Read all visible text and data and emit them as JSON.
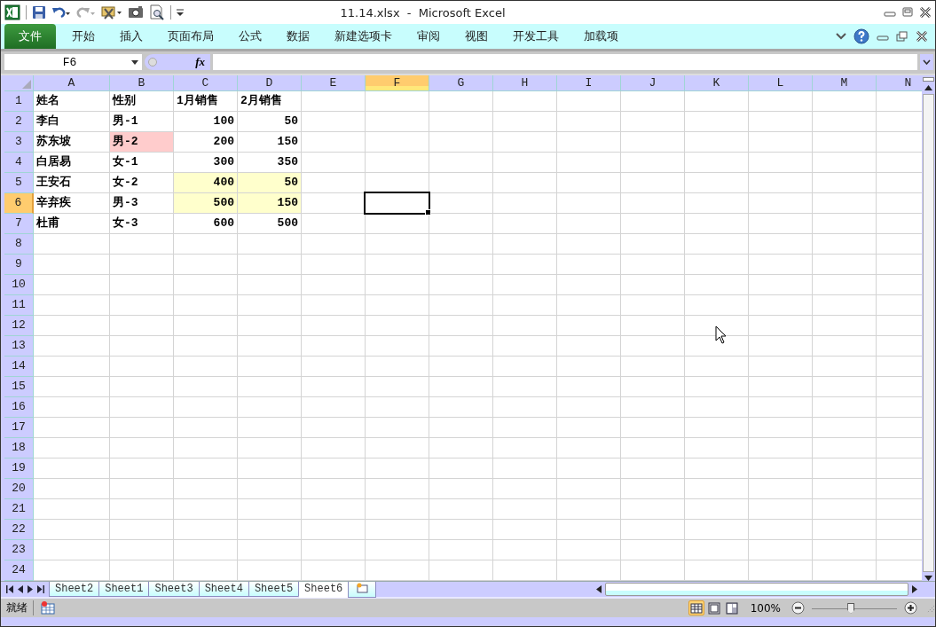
{
  "title_bar": {
    "title": "11.14.xlsx  -  Microsoft Excel"
  },
  "ribbon_tabs": [
    {
      "label": "文件",
      "kind": "file"
    },
    {
      "label": "开始",
      "kind": "tab"
    },
    {
      "label": "插入",
      "kind": "tab"
    },
    {
      "label": "页面布局",
      "kind": "tab"
    },
    {
      "label": "公式",
      "kind": "tab"
    },
    {
      "label": "数据",
      "kind": "tab"
    },
    {
      "label": "新建选项卡",
      "kind": "tab"
    },
    {
      "label": "审阅",
      "kind": "tab"
    },
    {
      "label": "视图",
      "kind": "tab"
    },
    {
      "label": "开发工具",
      "kind": "tab"
    },
    {
      "label": "加载项",
      "kind": "tab"
    }
  ],
  "formula_bar": {
    "name_box": "F6",
    "function_label": "fx"
  },
  "columns": [
    {
      "label": "A",
      "selected": false
    },
    {
      "label": "B",
      "selected": false
    },
    {
      "label": "C",
      "selected": false
    },
    {
      "label": "D",
      "selected": false
    },
    {
      "label": "E",
      "selected": false
    },
    {
      "label": "F",
      "selected": true
    },
    {
      "label": "G",
      "selected": false
    },
    {
      "label": "H",
      "selected": false
    },
    {
      "label": "I",
      "selected": false
    },
    {
      "label": "J",
      "selected": false
    },
    {
      "label": "K",
      "selected": false
    },
    {
      "label": "L",
      "selected": false
    },
    {
      "label": "M",
      "selected": false
    },
    {
      "label": "N",
      "selected": false
    }
  ],
  "rows": [
    {
      "label": "1",
      "selected": false,
      "cells": [
        {
          "text": "姓名",
          "kind": "text"
        },
        {
          "text": "性别",
          "kind": "text"
        },
        {
          "text": "1月销售",
          "kind": "text"
        },
        {
          "text": "2月销售",
          "kind": "text"
        }
      ]
    },
    {
      "label": "2",
      "selected": false,
      "cells": [
        {
          "text": "李白",
          "kind": "text"
        },
        {
          "text": "男-1",
          "kind": "text"
        },
        {
          "text": "100",
          "kind": "number"
        },
        {
          "text": "50",
          "kind": "number"
        }
      ]
    },
    {
      "label": "3",
      "selected": false,
      "cells": [
        {
          "text": "苏东坡",
          "kind": "text"
        },
        {
          "text": "男-2",
          "kind": "text",
          "color": "#ffcccc"
        },
        {
          "text": "200",
          "kind": "number"
        },
        {
          "text": "150",
          "kind": "number"
        }
      ]
    },
    {
      "label": "4",
      "selected": false,
      "cells": [
        {
          "text": "白居易",
          "kind": "text"
        },
        {
          "text": "女-1",
          "kind": "text"
        },
        {
          "text": "300",
          "kind": "number"
        },
        {
          "text": "350",
          "kind": "number"
        }
      ]
    },
    {
      "label": "5",
      "selected": false,
      "cells": [
        {
          "text": "王安石",
          "kind": "text"
        },
        {
          "text": "女-2",
          "kind": "text"
        },
        {
          "text": "400",
          "kind": "number",
          "color": "#ffffcc"
        },
        {
          "text": "50",
          "kind": "number",
          "color": "#ffffcc"
        }
      ]
    },
    {
      "label": "6",
      "selected": true,
      "cells": [
        {
          "text": "辛弃疾",
          "kind": "text"
        },
        {
          "text": "男-3",
          "kind": "text"
        },
        {
          "text": "500",
          "kind": "number",
          "color": "#ffffcc"
        },
        {
          "text": "150",
          "kind": "number",
          "color": "#ffffcc"
        }
      ]
    },
    {
      "label": "7",
      "selected": false,
      "cells": [
        {
          "text": "杜甫",
          "kind": "text"
        },
        {
          "text": "女-3",
          "kind": "text"
        },
        {
          "text": "600",
          "kind": "number"
        },
        {
          "text": "500",
          "kind": "number"
        }
      ]
    },
    {
      "label": "8",
      "selected": false
    },
    {
      "label": "9",
      "selected": false
    },
    {
      "label": "10",
      "selected": false
    },
    {
      "label": "11",
      "selected": false
    },
    {
      "label": "12",
      "selected": false
    },
    {
      "label": "13",
      "selected": false
    },
    {
      "label": "14",
      "selected": false
    },
    {
      "label": "15",
      "selected": false
    },
    {
      "label": "16",
      "selected": false
    },
    {
      "label": "17",
      "selected": false
    },
    {
      "label": "18",
      "selected": false
    },
    {
      "label": "19",
      "selected": false
    },
    {
      "label": "20",
      "selected": false
    },
    {
      "label": "21",
      "selected": false
    },
    {
      "label": "22",
      "selected": false
    },
    {
      "label": "23",
      "selected": false
    },
    {
      "label": "24",
      "selected": false
    }
  ],
  "sheet_tabs": [
    {
      "label": "Sheet2",
      "selected": false
    },
    {
      "label": "Sheet1",
      "selected": false
    },
    {
      "label": "Sheet3",
      "selected": false
    },
    {
      "label": "Sheet4",
      "selected": false
    },
    {
      "label": "Sheet5",
      "selected": false
    },
    {
      "label": "Sheet6",
      "selected": true
    }
  ],
  "status_bar": {
    "status": "就绪",
    "views": [
      {
        "kind": "normal",
        "selected": true
      },
      {
        "kind": "page-layout",
        "selected": false
      },
      {
        "kind": "page-break",
        "selected": false
      }
    ],
    "zoom": "100%",
    "zoom_slider": {
      "level": 0.46
    }
  }
}
